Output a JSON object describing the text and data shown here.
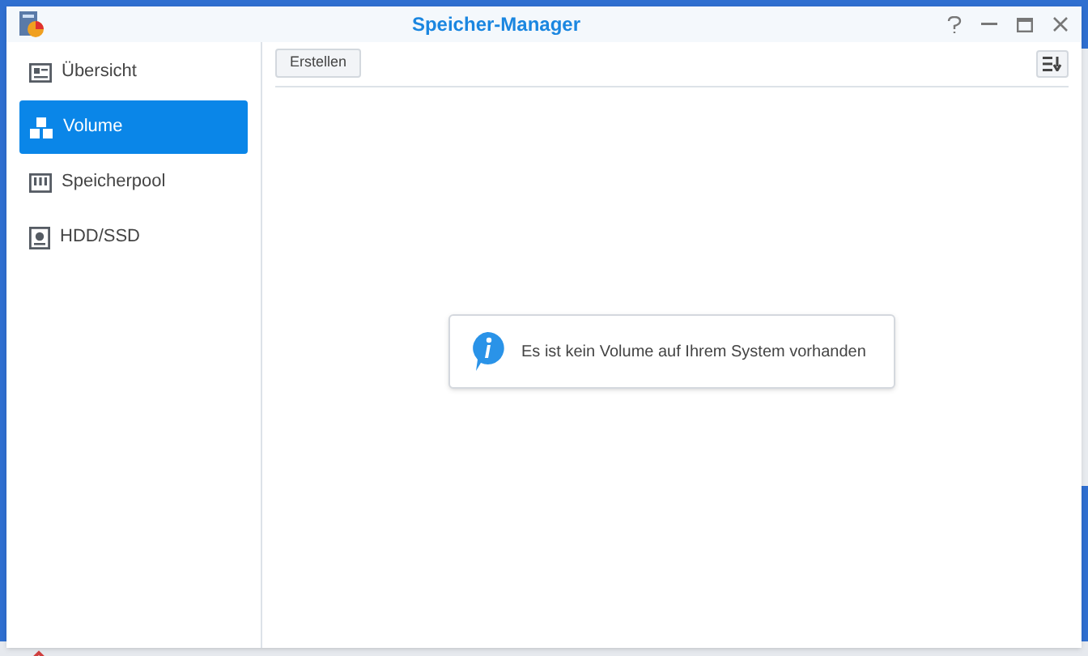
{
  "window": {
    "title": "Speicher-Manager"
  },
  "sidebar": {
    "items": [
      {
        "label": "Übersicht",
        "kind": "overview",
        "selected": false
      },
      {
        "label": "Volume",
        "kind": "volume",
        "selected": true
      },
      {
        "label": "Speicherpool",
        "kind": "pool",
        "selected": false
      },
      {
        "label": "HDD/SSD",
        "kind": "disk",
        "selected": false
      }
    ]
  },
  "toolbar": {
    "buttons": [
      "Erstellen"
    ]
  },
  "message": "Es ist kein Volume auf Ihrem System vorhanden"
}
